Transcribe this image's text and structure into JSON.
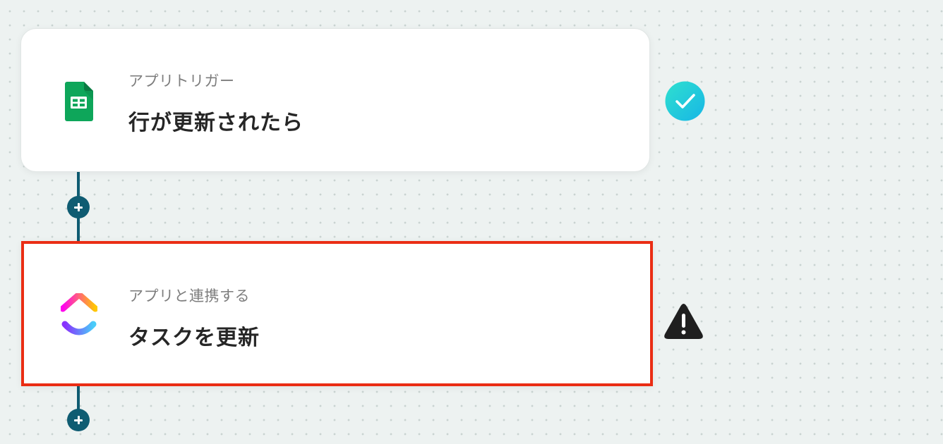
{
  "flow": {
    "steps": [
      {
        "label": "アプリトリガー",
        "title": "行が更新されたら",
        "app_icon": "google-sheets-icon",
        "status": "success",
        "status_icon": "check-circle-icon"
      },
      {
        "label": "アプリと連携する",
        "title": "タスクを更新",
        "app_icon": "clickup-icon",
        "status": "warning",
        "status_icon": "warning-icon"
      }
    ],
    "add_step_icon": "plus-icon"
  },
  "colors": {
    "background": "#edf2f1",
    "connector": "#0f5c72",
    "highlight_border": "#ea2d14",
    "success": "#22c7d9",
    "warning": "#1f1f1f",
    "sheets_green": "#0ea65a"
  }
}
